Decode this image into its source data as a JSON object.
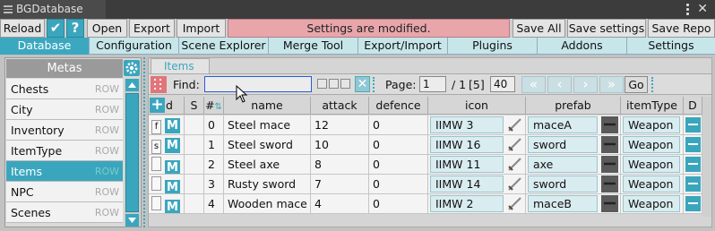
{
  "window": {
    "title": "BGDatabase"
  },
  "toolbar": {
    "reload": "Reload",
    "check_glyph": "✔",
    "help_glyph": "?",
    "open": "Open",
    "export": "Export",
    "import": "Import",
    "status": "Settings are modified.",
    "save_all": "Save All",
    "save_settings": "Save settings",
    "save_repo": "Save Repo",
    "status_color": "#e8a6ab"
  },
  "tabs": [
    {
      "label": "Database",
      "active": true
    },
    {
      "label": "Configuration"
    },
    {
      "label": "Scene Explorer"
    },
    {
      "label": "Merge Tool"
    },
    {
      "label": "Export/Import"
    },
    {
      "label": "Plugins"
    },
    {
      "label": "Addons"
    },
    {
      "label": "Settings"
    }
  ],
  "metas": {
    "header": "Metas",
    "items": [
      {
        "name": "Chests",
        "type": "ROW"
      },
      {
        "name": "City",
        "type": "ROW"
      },
      {
        "name": "Inventory",
        "type": "ROW"
      },
      {
        "name": "ItemType",
        "type": "ROW"
      },
      {
        "name": "Items",
        "type": "ROW",
        "selected": true
      },
      {
        "name": "NPC",
        "type": "ROW"
      },
      {
        "name": "Scenes",
        "type": "ROW"
      }
    ]
  },
  "content": {
    "tab": "Items",
    "find_label": "Find:",
    "find_value": "",
    "page_label": "Page:",
    "page_value": "1",
    "page_total": "/ 1",
    "page_count": "[5]",
    "page_size": "40",
    "go": "Go",
    "nav": [
      "«",
      "‹",
      "›",
      "»"
    ],
    "clear_glyph": "✕"
  },
  "table": {
    "columns": [
      "d",
      "S",
      "#",
      "name",
      "attack",
      "defence",
      "icon",
      "prefab",
      "itemType",
      "D"
    ],
    "rows": [
      {
        "flag": "f",
        "id": "0",
        "name": "Steel mace",
        "attack": "12",
        "defence": "0",
        "icon": "IIMW 3",
        "prefab": "maceA",
        "itemType": "Weapon"
      },
      {
        "flag": "s",
        "id": "1",
        "name": "Steel sword",
        "attack": "10",
        "defence": "0",
        "icon": "IIMW 16",
        "prefab": "sword",
        "itemType": "Weapon"
      },
      {
        "flag": "",
        "id": "2",
        "name": "Steel axe",
        "attack": "8",
        "defence": "0",
        "icon": "IIMW 11",
        "prefab": "axe",
        "itemType": "Weapon"
      },
      {
        "flag": "",
        "id": "3",
        "name": "Rusty sword",
        "attack": "7",
        "defence": "0",
        "icon": "IIMW 14",
        "prefab": "sword",
        "itemType": "Weapon"
      },
      {
        "flag": "",
        "id": "4",
        "name": "Wooden mace",
        "attack": "4",
        "defence": "0",
        "icon": "IIMW 2",
        "prefab": "maceB",
        "itemType": "Weapon"
      }
    ],
    "m_label": "M",
    "plus_glyph": "+",
    "sort_glyph": "⇅"
  },
  "icons": [
    "gear-icon",
    "menu-dots-icon",
    "close-icon",
    "drag-handle-icon",
    "weapon-thumbnail-icon",
    "prefab-thumbnail-icon"
  ],
  "colors": {
    "accent": "#3aa6bd",
    "status_bg": "#e8a6ab",
    "titlebar": "#3c3c3c"
  }
}
